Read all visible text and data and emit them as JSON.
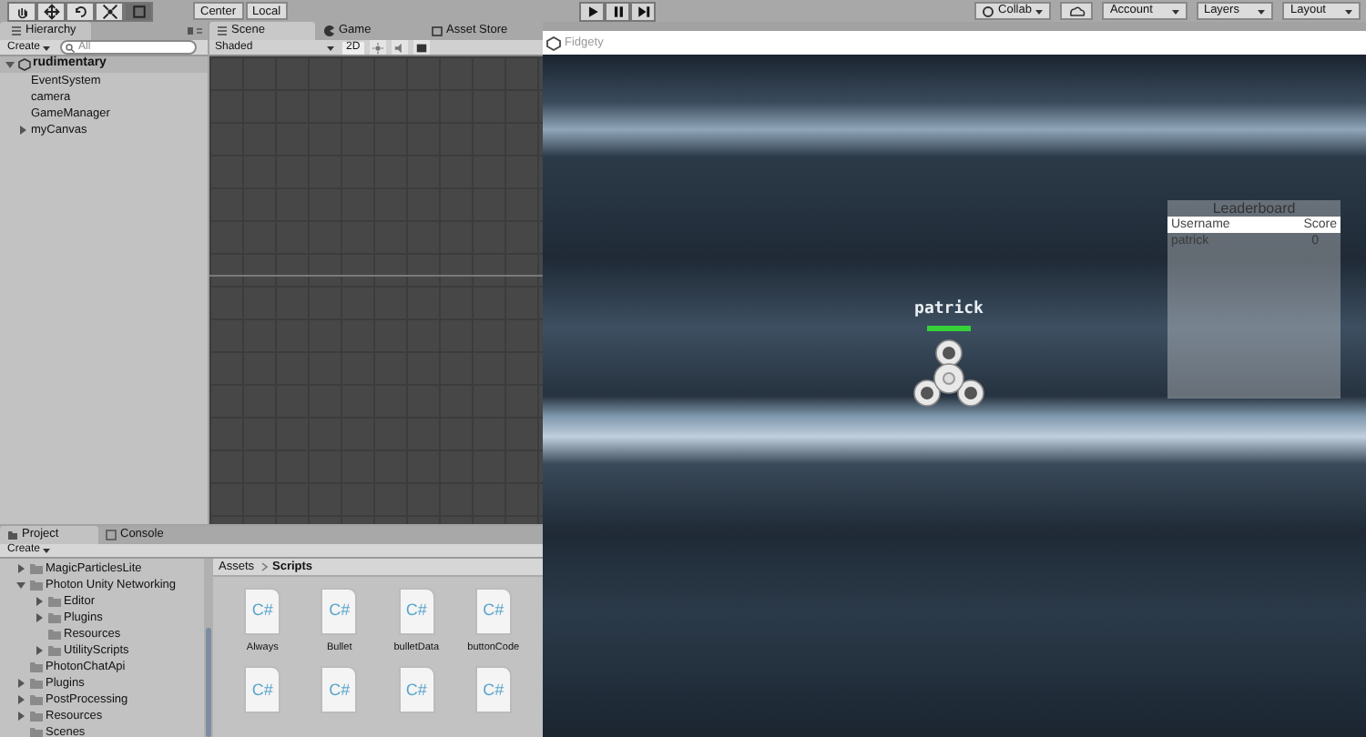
{
  "toolbar": {
    "tools": [
      {
        "kind": "hand",
        "selected": false
      },
      {
        "kind": "move",
        "selected": false
      },
      {
        "kind": "rotate",
        "selected": false
      },
      {
        "kind": "scale",
        "selected": false
      },
      {
        "kind": "rect",
        "selected": true
      }
    ],
    "pivot": [
      "Center",
      "Local"
    ],
    "right_buttons": [
      {
        "kind": "collab",
        "label": "Collab"
      },
      {
        "kind": "cloud"
      },
      {
        "kind": "dropdown",
        "label": "Account"
      },
      {
        "kind": "dropdown",
        "label": "Layers"
      },
      {
        "kind": "dropdown",
        "label": "Layout"
      }
    ]
  },
  "hierarchy": {
    "tab": "Hierarchy",
    "create": "Create",
    "search_placeholder": "All",
    "scene": {
      "label": "rudimentary",
      "expanded": true,
      "children": [
        {
          "label": "EventSystem"
        },
        {
          "label": "camera"
        },
        {
          "label": "GameManager"
        },
        {
          "label": "myCanvas",
          "expanded": false
        }
      ]
    }
  },
  "scene_tabs": [
    {
      "kind": "scene",
      "label": "Scene",
      "selected": true
    },
    {
      "kind": "game",
      "label": "Game",
      "selected": false
    },
    {
      "kind": "store",
      "label": "Asset Store",
      "selected": false
    }
  ],
  "scene_toolbar": {
    "shading": "Shaded",
    "mode_2d": "2D"
  },
  "game_window": {
    "title": "Fidgety",
    "player": {
      "name": "patrick",
      "health": {
        "level": 1
      }
    },
    "leaderboard": {
      "title": "Leaderboard",
      "columns": [
        "Username",
        "Score"
      ],
      "rows": [
        [
          "patrick",
          "0"
        ]
      ]
    }
  },
  "project": {
    "tabs": [
      {
        "label": "Project",
        "selected": true
      },
      {
        "label": "Console",
        "selected": false
      }
    ],
    "create": "Create",
    "tree": [
      {
        "label": "MagicParticlesLite",
        "expanded": false
      },
      {
        "label": "Photon Unity Networking",
        "expanded": true,
        "children": [
          {
            "label": "Editor",
            "expanded": false
          },
          {
            "label": "Plugins",
            "expanded": false
          },
          {
            "label": "Resources"
          },
          {
            "label": "UtilityScripts",
            "expanded": false
          }
        ]
      },
      {
        "label": "PhotonChatApi"
      },
      {
        "label": "Plugins",
        "expanded": false
      },
      {
        "label": "PostProcessing",
        "expanded": false
      },
      {
        "label": "Resources",
        "expanded": false
      },
      {
        "label": "Scenes"
      }
    ],
    "breadcrumb": [
      "Assets",
      "Scripts"
    ],
    "assets": [
      {
        "icon_text": "C#",
        "label": "Always"
      },
      {
        "icon_text": "C#",
        "label": "Bullet"
      },
      {
        "icon_text": "C#",
        "label": "bulletData"
      },
      {
        "icon_text": "C#",
        "label": "buttonCode"
      },
      {
        "icon_text": "C#"
      },
      {
        "icon_text": "C#"
      },
      {
        "icon_text": "C#"
      },
      {
        "icon_text": "C#"
      }
    ]
  }
}
